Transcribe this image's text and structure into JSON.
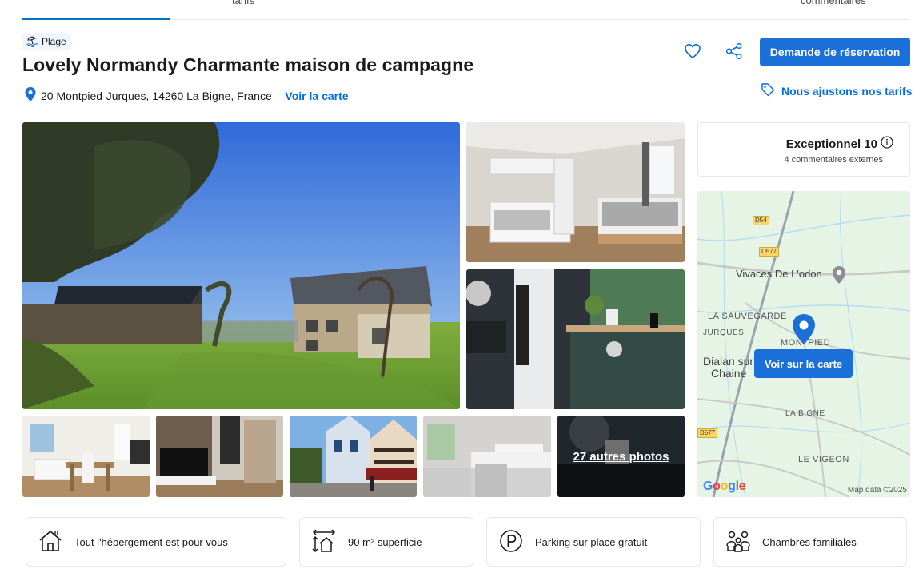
{
  "tabs": [
    "tarifs",
    "commentaires"
  ],
  "badge": {
    "label": "Plage",
    "icon": "beach-icon"
  },
  "property": {
    "title": "Lovely Normandy Charmante maison de campagne",
    "address": "20 Montpied-Jurques, 14260 La Bigne, France –",
    "map_link": "Voir la carte"
  },
  "actions": {
    "reserve": "Demande de réservation",
    "price_match": "Nous ajustons nos tarifs"
  },
  "gallery": {
    "more_photos": "27 autres photos"
  },
  "review": {
    "label": "Exceptionnel 10",
    "sub": "4 commentaires externes"
  },
  "map": {
    "button": "Voir sur la carte",
    "places": {
      "vivaces": "Vivaces De L'odon",
      "sauvegarde": "LA SAUVEGARDE",
      "jurques": "JURQUES",
      "montpied": "MONTPIED",
      "dialan": "Dialan sur",
      "chaine": "Chaine",
      "labigne": "LA BIGNE",
      "vigeon": "LE VIGEON"
    },
    "roads": [
      "D54",
      "D577",
      "D577"
    ],
    "attribution": "Google",
    "map_data": "Map data ©2025"
  },
  "facilities": [
    {
      "label": "Tout l'hébergement est pour vous",
      "icon": "house-icon"
    },
    {
      "label": "90 m² superficie",
      "icon": "area-icon"
    },
    {
      "label": "Parking sur place gratuit",
      "icon": "parking-icon"
    },
    {
      "label": "Chambres familiales",
      "icon": "family-icon"
    }
  ],
  "colors": {
    "primary": "#1a6fd8",
    "link": "#006ce4"
  }
}
